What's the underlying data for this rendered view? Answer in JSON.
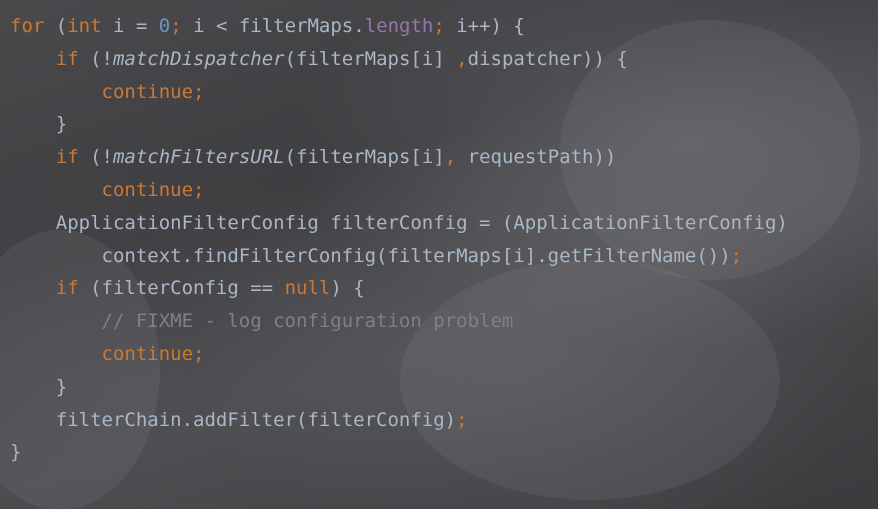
{
  "editor": {
    "lines": [
      {
        "tokens": [
          {
            "t": "for",
            "c": "kw"
          },
          {
            "t": " (",
            "c": ""
          },
          {
            "t": "int",
            "c": "kw"
          },
          {
            "t": " i = ",
            "c": ""
          },
          {
            "t": "0",
            "c": "num"
          },
          {
            "t": ";",
            "c": "semi"
          },
          {
            "t": " i < filterMaps.",
            "c": ""
          },
          {
            "t": "length",
            "c": "field"
          },
          {
            "t": ";",
            "c": "semi"
          },
          {
            "t": " i++) {",
            "c": ""
          }
        ]
      },
      {
        "tokens": [
          {
            "t": "    ",
            "c": ""
          },
          {
            "t": "if",
            "c": "kw"
          },
          {
            "t": " (!",
            "c": ""
          },
          {
            "t": "matchDispatcher",
            "c": "fn-italic"
          },
          {
            "t": "(filterMaps[i] ",
            "c": ""
          },
          {
            "t": ",",
            "c": "semi"
          },
          {
            "t": "dispatcher)) {",
            "c": ""
          }
        ]
      },
      {
        "tokens": [
          {
            "t": "        ",
            "c": ""
          },
          {
            "t": "continue",
            "c": "kw"
          },
          {
            "t": ";",
            "c": "semi"
          }
        ]
      },
      {
        "tokens": [
          {
            "t": "    }",
            "c": ""
          }
        ]
      },
      {
        "tokens": [
          {
            "t": "    ",
            "c": ""
          },
          {
            "t": "if",
            "c": "kw"
          },
          {
            "t": " (!",
            "c": ""
          },
          {
            "t": "matchFiltersURL",
            "c": "fn-italic"
          },
          {
            "t": "(filterMaps[i]",
            "c": ""
          },
          {
            "t": ",",
            "c": "semi"
          },
          {
            "t": " requestPath))",
            "c": ""
          }
        ]
      },
      {
        "tokens": [
          {
            "t": "        ",
            "c": ""
          },
          {
            "t": "continue",
            "c": "kw"
          },
          {
            "t": ";",
            "c": "semi"
          }
        ]
      },
      {
        "tokens": [
          {
            "t": "    ApplicationFilterConfig filterConfig = (ApplicationFilterConfig)",
            "c": ""
          }
        ]
      },
      {
        "tokens": [
          {
            "t": "        context.findFilterConfig(filterMaps[i].getFilterName())",
            "c": ""
          },
          {
            "t": ";",
            "c": "semi"
          }
        ]
      },
      {
        "tokens": [
          {
            "t": "    ",
            "c": ""
          },
          {
            "t": "if",
            "c": "kw"
          },
          {
            "t": " (filterConfig == ",
            "c": ""
          },
          {
            "t": "null",
            "c": "kw"
          },
          {
            "t": ") {",
            "c": ""
          }
        ]
      },
      {
        "tokens": [
          {
            "t": "        ",
            "c": ""
          },
          {
            "t": "// FIXME - log configuration problem",
            "c": "comment"
          }
        ]
      },
      {
        "tokens": [
          {
            "t": "        ",
            "c": ""
          },
          {
            "t": "continue",
            "c": "kw"
          },
          {
            "t": ";",
            "c": "semi"
          }
        ]
      },
      {
        "tokens": [
          {
            "t": "    }",
            "c": ""
          }
        ]
      },
      {
        "tokens": [
          {
            "t": "    filterChain.addFilter(filterConfig)",
            "c": ""
          },
          {
            "t": ";",
            "c": "semi"
          }
        ]
      },
      {
        "tokens": [
          {
            "t": "}",
            "c": ""
          }
        ]
      }
    ]
  }
}
